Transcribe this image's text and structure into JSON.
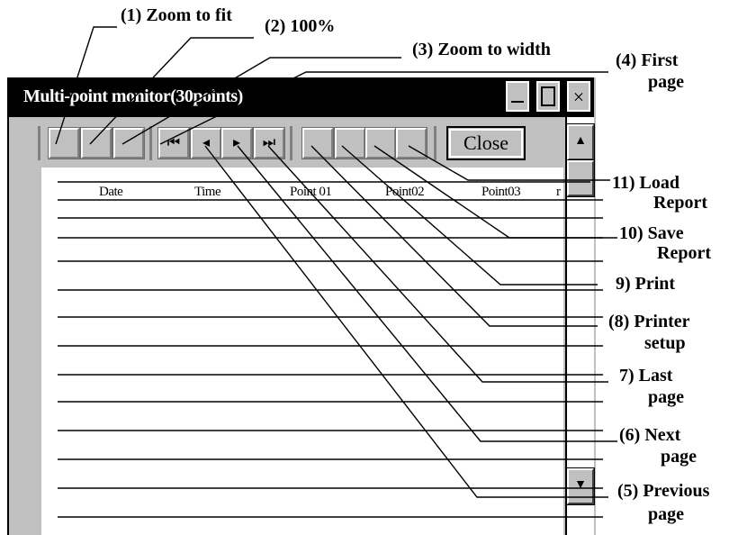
{
  "window": {
    "title": "Multi-point monitor(30points)",
    "buttons": {
      "minimize_icon": "minimize-icon",
      "maximize_icon": "maximize-icon",
      "close_glyph": "×"
    }
  },
  "toolbar": {
    "close_label": "Close",
    "icons": {
      "first_page": "⏮",
      "previous_page": "◂",
      "next_page": "▸",
      "last_page": "⏭"
    }
  },
  "report": {
    "columns": [
      "Date",
      "Time",
      "Point 01",
      "Point02",
      "Point03",
      "r"
    ]
  },
  "scrollbar": {
    "up": "▲",
    "down": "▼"
  },
  "callouts": {
    "zoom_to_fit": "(1) Zoom to fit",
    "zoom_100": "(2) 100%",
    "zoom_to_width": "(3) Zoom to width",
    "first_page_1": "(4) First",
    "first_page_2": "page",
    "previous_page_1": "(5) Previous",
    "previous_page_2": "page",
    "next_page_1": "(6) Next",
    "next_page_2": "page",
    "last_page_1": "7) Last",
    "last_page_2": "page",
    "printer_setup_1": "(8) Printer",
    "printer_setup_2": "setup",
    "print": "9) Print",
    "save_report_1": "10) Save",
    "save_report_2": "Report",
    "load_report_1": "11) Load",
    "load_report_2": "Report"
  }
}
